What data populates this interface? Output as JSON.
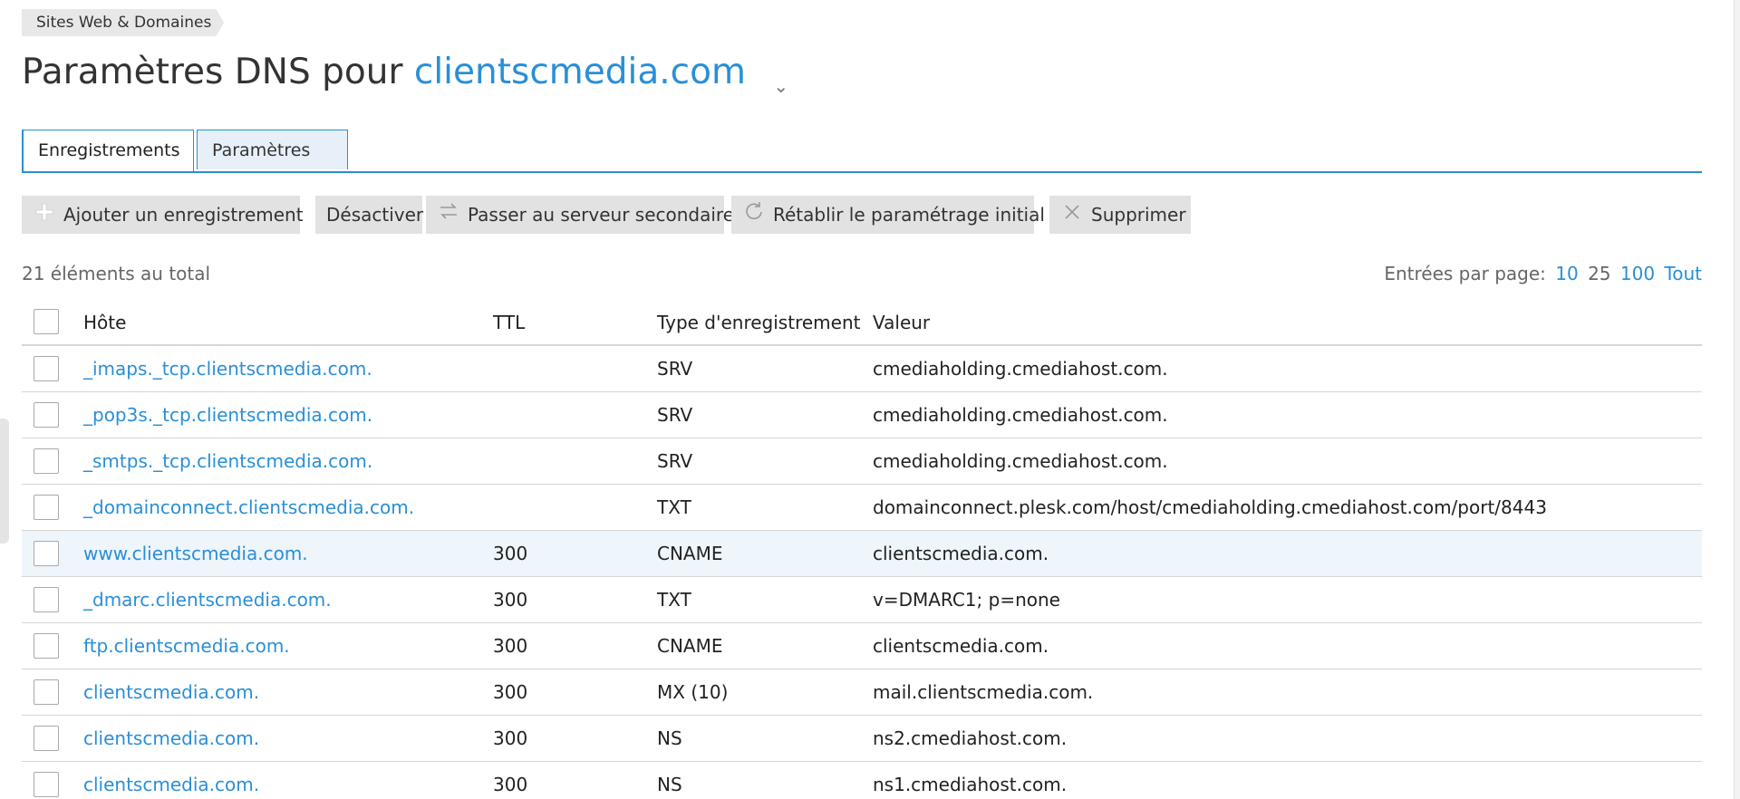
{
  "breadcrumb": "Sites Web & Domaines",
  "title": {
    "prefix": "Paramètres DNS pour",
    "domain": "clientscmedia.com",
    "caret": "⌄"
  },
  "tabs": [
    {
      "label": "Enregistrements",
      "active": true
    },
    {
      "label": "Paramètres",
      "active": false
    }
  ],
  "toolbar": {
    "add": "Ajouter un enregistrement",
    "disable": "Désactiver",
    "secondary": "Passer au serveur secondaire",
    "restore": "Rétablir le paramétrage initial",
    "delete": "Supprimer",
    "icons": {
      "add": "plus-icon",
      "secondary": "switch-arrows-icon",
      "restore": "refresh-icon",
      "delete": "remove-x-icon"
    }
  },
  "total": "21 éléments au total",
  "pagination": {
    "label": "Entrées par page:",
    "options": [
      "10",
      "25",
      "100",
      "Tout"
    ],
    "current": "25"
  },
  "table": {
    "headers": {
      "host": "Hôte",
      "ttl": "TTL",
      "type": "Type d'enregistrement",
      "value": "Valeur"
    },
    "rows": [
      {
        "host": "_imaps._tcp.clientscmedia.com.",
        "ttl": "",
        "type": "SRV",
        "value": "cmediaholding.cmediahost.com."
      },
      {
        "host": "_pop3s._tcp.clientscmedia.com.",
        "ttl": "",
        "type": "SRV",
        "value": "cmediaholding.cmediahost.com."
      },
      {
        "host": "_smtps._tcp.clientscmedia.com.",
        "ttl": "",
        "type": "SRV",
        "value": "cmediaholding.cmediahost.com."
      },
      {
        "host": "_domainconnect.clientscmedia.com.",
        "ttl": "",
        "type": "TXT",
        "value": "domainconnect.plesk.com/host/cmediaholding.cmediahost.com/port/8443"
      },
      {
        "host": "www.clientscmedia.com.",
        "ttl": "300",
        "type": "CNAME",
        "value": "clientscmedia.com.",
        "highlighted": true
      },
      {
        "host": "_dmarc.clientscmedia.com.",
        "ttl": "300",
        "type": "TXT",
        "value": "v=DMARC1; p=none"
      },
      {
        "host": "ftp.clientscmedia.com.",
        "ttl": "300",
        "type": "CNAME",
        "value": "clientscmedia.com."
      },
      {
        "host": "clientscmedia.com.",
        "ttl": "300",
        "type": "MX (10)",
        "value": "mail.clientscmedia.com."
      },
      {
        "host": "clientscmedia.com.",
        "ttl": "300",
        "type": "NS",
        "value": "ns2.cmediahost.com."
      },
      {
        "host": "clientscmedia.com.",
        "ttl": "300",
        "type": "NS",
        "value": "ns1.cmediahost.com."
      }
    ]
  },
  "colors": {
    "accent": "#2a8fd6",
    "row_highlight": "#eef5fb",
    "button_bg": "#e2e2e2"
  }
}
